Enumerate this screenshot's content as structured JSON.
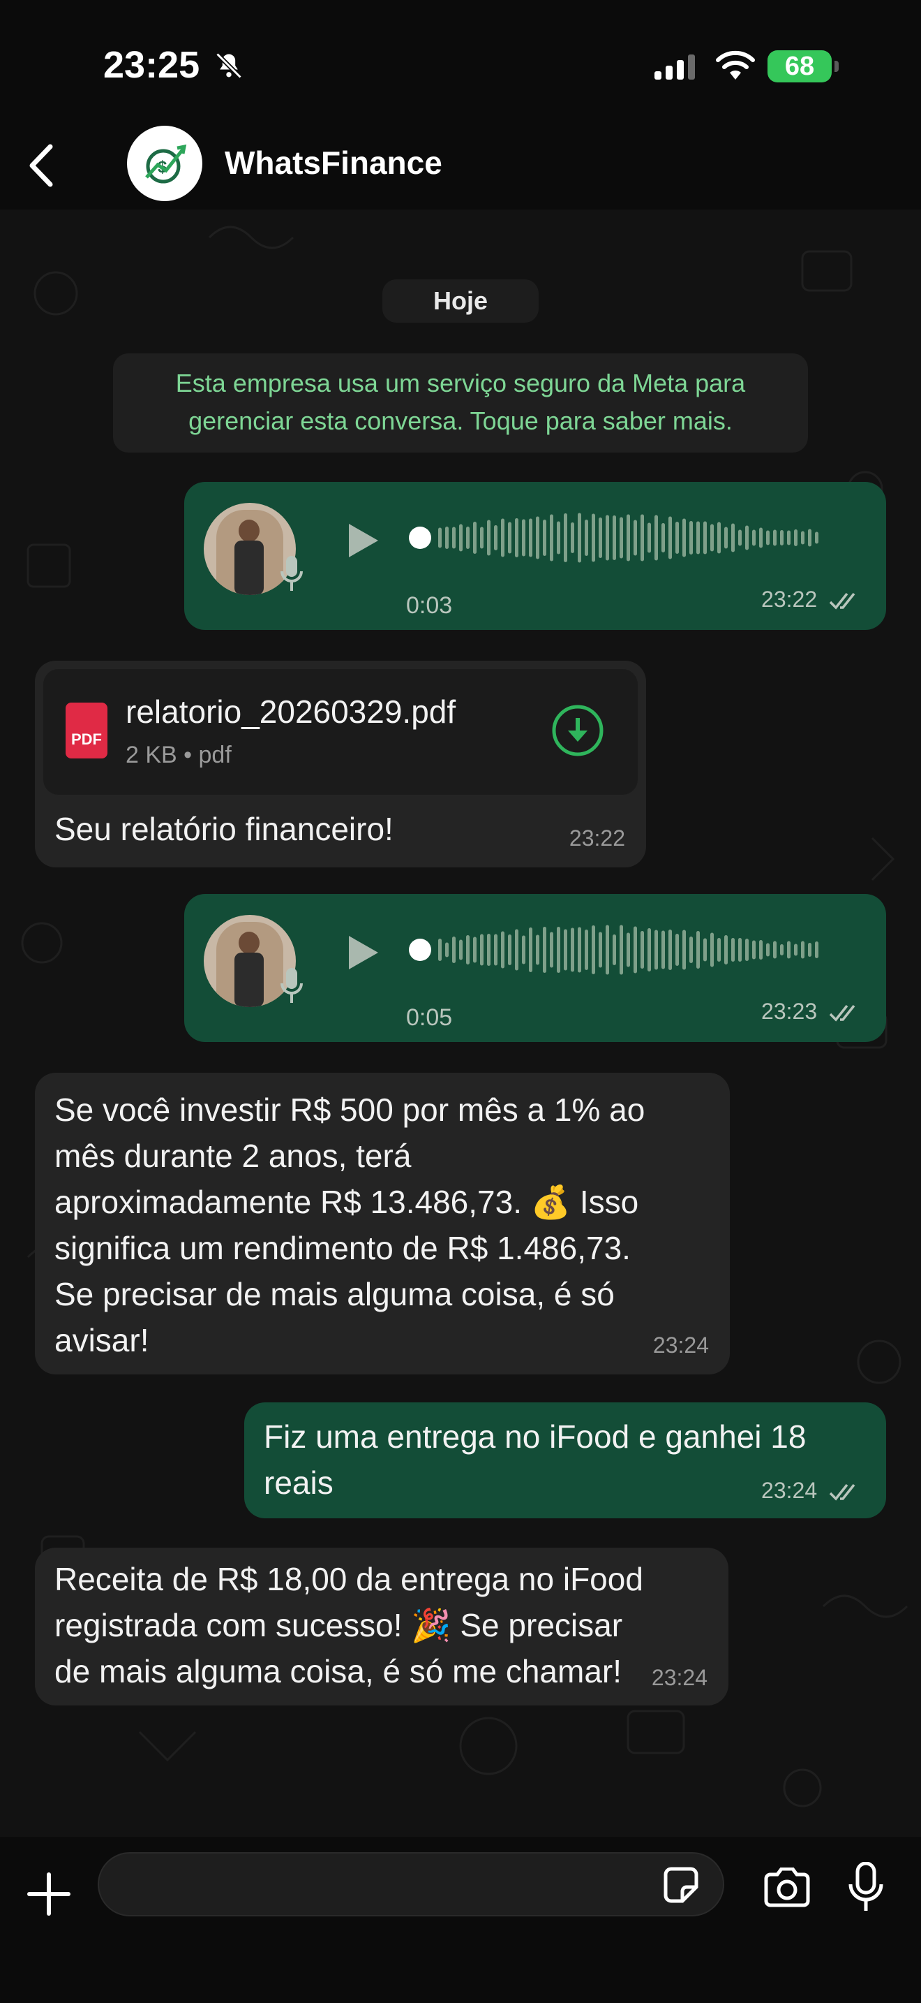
{
  "status_bar": {
    "time": "23:25",
    "battery": "68"
  },
  "header": {
    "contact_name": "WhatsFinance"
  },
  "chat": {
    "date_chip": "Hoje",
    "notice_line1": "Esta empresa usa um serviço seguro da Meta para",
    "notice_line2": "gerenciar esta conversa. Toque para saber mais.",
    "messages": [
      {
        "type": "voice",
        "direction": "out",
        "duration": "0:03",
        "time": "23:22"
      },
      {
        "type": "document",
        "direction": "in",
        "file_name": "relatorio_20260329.pdf",
        "file_info": "2 KB • pdf",
        "pdf_label": "PDF",
        "caption": "Seu relatório financeiro!",
        "time": "23:22"
      },
      {
        "type": "voice",
        "direction": "out",
        "duration": "0:05",
        "time": "23:23"
      },
      {
        "type": "text",
        "direction": "in",
        "lines": [
          "Se você investir R$ 500 por mês a 1% ao",
          "mês durante 2 anos, terá",
          "aproximadamente R$ 13.486,73. 💰 Isso",
          "significa um rendimento de R$ 1.486,73.",
          "Se precisar de mais alguma coisa, é só",
          "avisar!"
        ],
        "time": "23:24"
      },
      {
        "type": "text",
        "direction": "out",
        "lines": [
          "Fiz uma entrega no iFood e ganhei 18",
          "reais"
        ],
        "time": "23:24"
      },
      {
        "type": "text",
        "direction": "in",
        "lines": [
          "Receita de R$ 18,00 da entrega no iFood",
          "registrada com sucesso! 🎉 Se precisar",
          "de mais alguma coisa, é só me chamar!"
        ],
        "time": "23:24"
      }
    ]
  },
  "composer": {
    "placeholder": ""
  },
  "colors": {
    "accent_green": "#134d37",
    "incoming_bubble": "#242424",
    "notice_text": "#7ed695",
    "tick_color": "#b9c6bd"
  }
}
